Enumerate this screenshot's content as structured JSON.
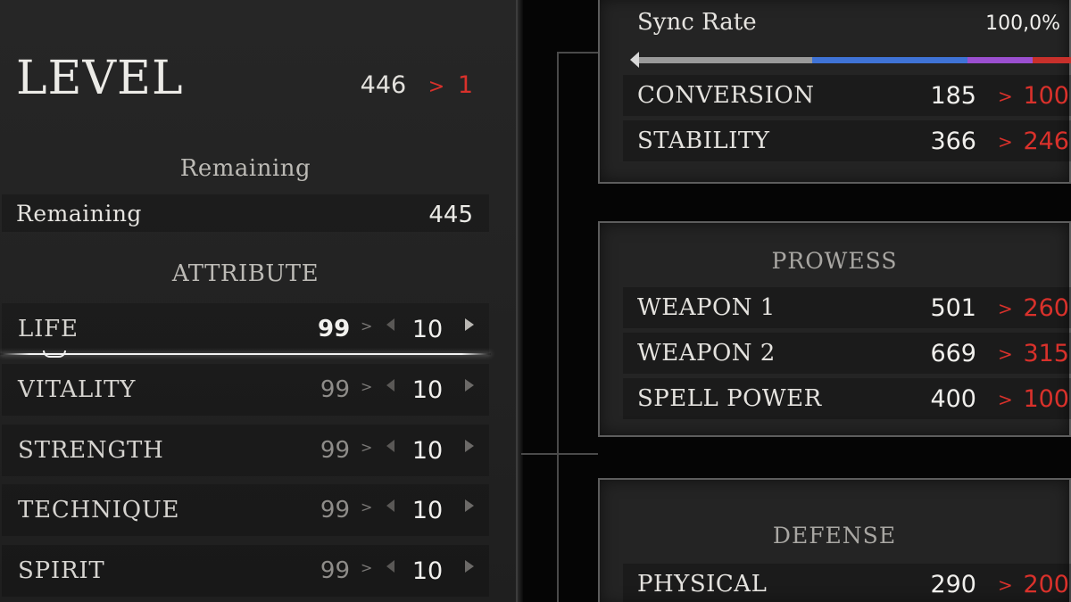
{
  "level": {
    "title": "LEVEL",
    "current": "446",
    "arrow": ">",
    "next": "1"
  },
  "remaining": {
    "heading": "Remaining",
    "label": "Remaining",
    "value": "445"
  },
  "attributes": {
    "heading": "ATTRIBUTE",
    "items": [
      {
        "label": "LIFE",
        "base": "99",
        "gt": ">",
        "value": "10"
      },
      {
        "label": "VITALITY",
        "base": "99",
        "gt": ">",
        "value": "10"
      },
      {
        "label": "STRENGTH",
        "base": "99",
        "gt": ">",
        "value": "10"
      },
      {
        "label": "TECHNIQUE",
        "base": "99",
        "gt": ">",
        "value": "10"
      },
      {
        "label": "SPIRIT",
        "base": "99",
        "gt": ">",
        "value": "10"
      }
    ]
  },
  "sync": {
    "label": "Sync Rate",
    "value": "100,0%",
    "bar_segments": [
      {
        "color": "#9a9a9a",
        "share": 0.4
      },
      {
        "color": "#3f73d6",
        "share": 0.36
      },
      {
        "color": "#9b4fd0",
        "share": 0.15
      },
      {
        "color": "#c8302b",
        "share": 0.09
      }
    ],
    "rows": [
      {
        "label": "CONVERSION",
        "value": "185",
        "arrow": ">",
        "new": "100"
      },
      {
        "label": "STABILITY",
        "value": "366",
        "arrow": ">",
        "new": "246"
      }
    ]
  },
  "prowess": {
    "heading": "PROWESS",
    "rows": [
      {
        "label": "WEAPON 1",
        "value": "501",
        "arrow": ">",
        "new": "260"
      },
      {
        "label": "WEAPON 2",
        "value": "669",
        "arrow": ">",
        "new": "315"
      },
      {
        "label": "SPELL POWER",
        "value": "400",
        "arrow": ">",
        "new": "100"
      }
    ]
  },
  "defense": {
    "heading": "DEFENSE",
    "rows": [
      {
        "label": "PHYSICAL",
        "value": "290",
        "arrow": ">",
        "new": "200"
      }
    ]
  },
  "colors": {
    "accent_red": "#d9312b",
    "panel_bg": "#242424",
    "text": "#e6e4e0"
  }
}
